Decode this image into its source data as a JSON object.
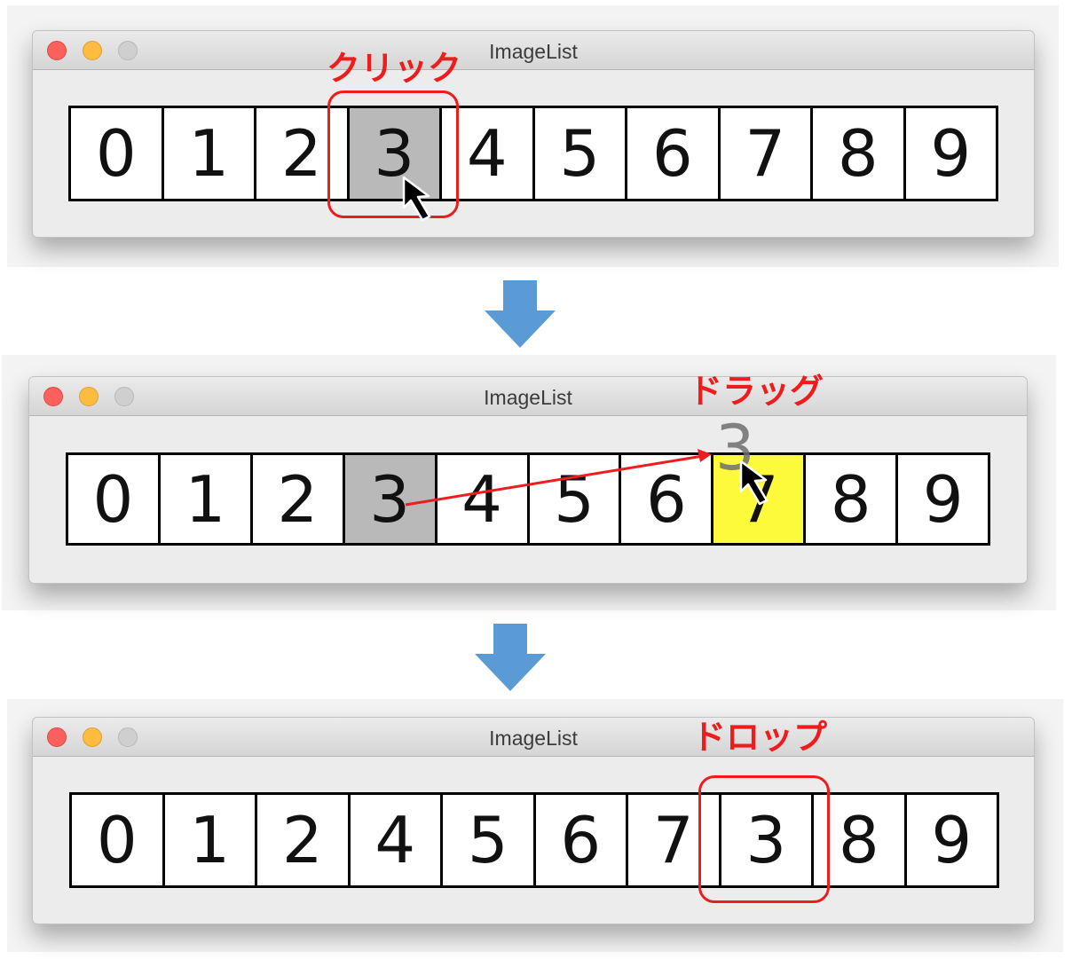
{
  "steps": [
    {
      "window_title": "ImageList",
      "annotation": "クリック",
      "items": [
        "0",
        "1",
        "2",
        "3",
        "4",
        "5",
        "6",
        "7",
        "8",
        "9"
      ]
    },
    {
      "window_title": "ImageList",
      "annotation": "ドラッグ",
      "items": [
        "0",
        "1",
        "2",
        "3",
        "4",
        "5",
        "6",
        "7",
        "8",
        "9"
      ],
      "dragged_item": "3"
    },
    {
      "window_title": "ImageList",
      "annotation": "ドロップ",
      "items": [
        "0",
        "1",
        "2",
        "4",
        "5",
        "6",
        "7",
        "3",
        "8",
        "9"
      ]
    }
  ],
  "colors": {
    "annotation": "#ee1c1c",
    "arrow": "#5b9bd5",
    "selected_cell": "#b9b9b9",
    "drop_target": "#fdfa3b",
    "drag_line": "#ee1c1c"
  },
  "icons": [
    "close-button-icon",
    "minimize-button-icon",
    "zoom-button-icon",
    "mouse-pointer-icon",
    "down-arrow-icon"
  ]
}
